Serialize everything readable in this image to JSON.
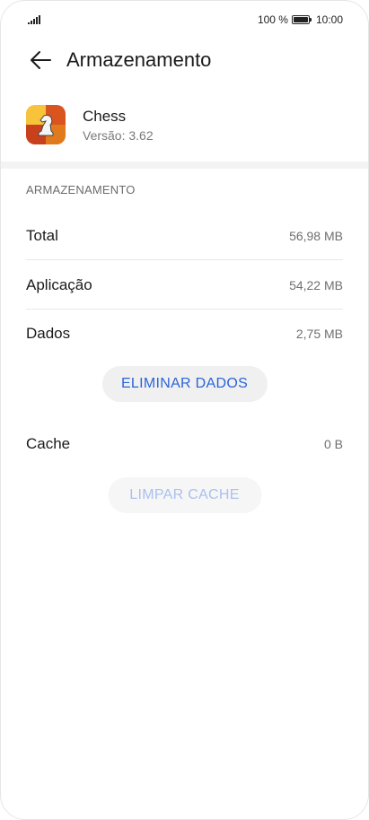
{
  "status_bar": {
    "battery_percent": "100 %",
    "time": "10:00"
  },
  "header": {
    "back_icon": "arrow-left-icon",
    "title": "Armazenamento"
  },
  "app": {
    "icon": "chess-app-icon",
    "name": "Chess",
    "version": "Versão: 3.62"
  },
  "storage": {
    "section_title": "ARMAZENAMENTO",
    "rows": [
      {
        "label": "Total",
        "value": "56,98 MB"
      },
      {
        "label": "Aplicação",
        "value": "54,22 MB"
      },
      {
        "label": "Dados",
        "value": "2,75 MB"
      }
    ],
    "delete_data_label": "ELIMINAR DADOS",
    "cache_label": "Cache",
    "cache_value": "0 B",
    "clear_cache_label": "LIMPAR CACHE"
  },
  "colors": {
    "accent": "#2b64d8",
    "accent_disabled": "#a9c1ee"
  }
}
